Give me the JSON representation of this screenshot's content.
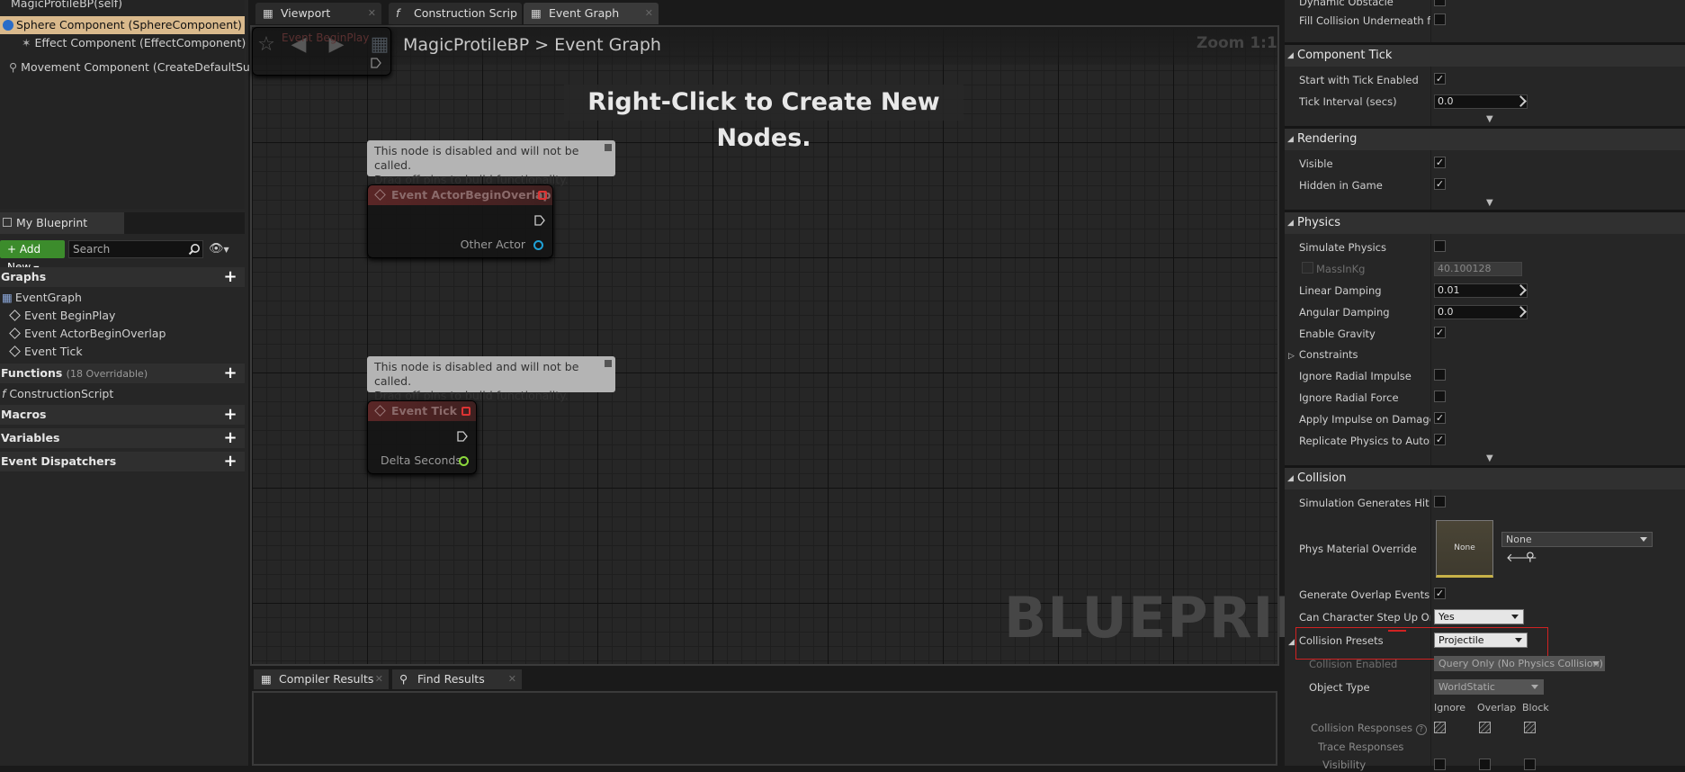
{
  "components": {
    "rows": [
      "MagicProtileBP(self)",
      "Sphere Component (SphereComponent) (Inhe",
      "Effect Component (EffectComponent) (Inhe",
      "Movement Component (CreateDefaultSubobj"
    ]
  },
  "my_blueprint": {
    "tab_label": "My Blueprint",
    "add_new_label": "Add New",
    "search_placeholder": "Search",
    "graphs_label": "Graphs",
    "graph_items": [
      "EventGraph",
      "Event BeginPlay",
      "Event ActorBeginOverlap",
      "Event Tick"
    ],
    "functions_label": "Functions",
    "functions_count": "(18 Overridable)",
    "function_items": [
      "ConstructionScript"
    ],
    "macros_label": "Macros",
    "variables_label": "Variables",
    "dispatchers_label": "Event Dispatchers"
  },
  "doc_tabs": [
    "Viewport",
    "Construction Scrip",
    "Event Graph"
  ],
  "graph": {
    "breadcrumb_bp": "MagicProtileBP",
    "breadcrumb_sep": ">",
    "breadcrumb_graph": "Event Graph",
    "zoom": "Zoom 1:1",
    "hint": "Right-Click to Create New Nodes.",
    "watermark": "BLUEPRINT",
    "comment_line1": "This node is disabled and will not be called.",
    "comment_line2": "Drag off pins to build functionality.",
    "node1_title": "Event ActorBeginOverlap",
    "node1_pin": "Other Actor",
    "node2_title": "Event Tick",
    "node2_pin": "Delta Seconds",
    "partial_node_title": "Event BeginPlay"
  },
  "bottom_tabs": [
    "Compiler Results",
    "Find Results"
  ],
  "details": {
    "top_labels": [
      "Dynamic Obstacle",
      "Fill Collision Underneath for N"
    ],
    "component_tick": {
      "title": "Component Tick",
      "start_with_tick": "Start with Tick Enabled",
      "tick_interval": "Tick Interval (secs)",
      "tick_interval_value": "0.0"
    },
    "rendering": {
      "title": "Rendering",
      "visible": "Visible",
      "hidden_in_game": "Hidden in Game"
    },
    "physics": {
      "title": "Physics",
      "simulate": "Simulate Physics",
      "mass": "MassInKg",
      "mass_value": "40.100128",
      "linear_damping": "Linear Damping",
      "linear_damping_value": "0.01",
      "angular_damping": "Angular Damping",
      "angular_damping_value": "0.0",
      "enable_gravity": "Enable Gravity",
      "constraints": "Constraints",
      "ignore_radial_impulse": "Ignore Radial Impulse",
      "ignore_radial_force": "Ignore Radial Force",
      "apply_impulse": "Apply Impulse on Damage",
      "replicate_physics": "Replicate Physics to Autonom"
    },
    "collision": {
      "title": "Collision",
      "sim_hit_events": "Simulation Generates Hit Eve",
      "phys_material": "Phys Material Override",
      "phys_material_thumb": "None",
      "phys_material_value": "None",
      "gen_overlap": "Generate Overlap Events",
      "step_up": "Can Character Step Up On",
      "step_up_value": "Yes",
      "presets": "Collision Presets",
      "presets_value": "Projectile",
      "enabled": "Collision Enabled",
      "enabled_value": "Query Only (No Physics Collision)",
      "object_type": "Object Type",
      "object_type_value": "WorldStatic",
      "col_ignore": "Ignore",
      "col_overlap": "Overlap",
      "col_block": "Block",
      "responses": "Collision Responses",
      "trace_responses": "Trace Responses",
      "visibility": "Visibility"
    }
  },
  "colors": {
    "accent_add": "#3c8c2c",
    "selection": "#d9b98c",
    "highlight": "#d02222"
  }
}
